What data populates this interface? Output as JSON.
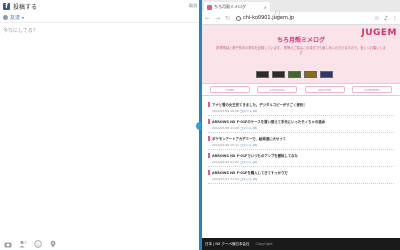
{
  "composer": {
    "title": "投稿する",
    "cancel": "取消",
    "privacy": "友達",
    "placeholder": "今なにしてる？"
  },
  "browser": {
    "tab_title": "ちろ月殻ミメログ",
    "url": "chi-ko0901.jugem.jp"
  },
  "blog": {
    "brand": "JUGEM",
    "title": "ちろ月殻ミメログ",
    "description": "携帯電話と電子系中の事件を記録しています。 携帯のご覧はこの書式でも楽しみいただけますので、宜しくお願いします",
    "menu": [
      "HOME",
      "CATEGORY",
      "ARCHIVE",
      "COMMENT"
    ],
    "posts": [
      {
        "title": "アナと雪の女王見てきました。デジタルコピーがすごく便利！",
        "date": "2014/07/29 19:56",
        "comments": "コメント (0)"
      },
      {
        "title": "ARROWS NX F-01Fのケースを買い替えて手元にいったモノちゃの道余",
        "date": "2014/07/28 11:08",
        "comments": "コメント (0)"
      },
      {
        "title": "ポケモンアートアカデミーで、絵師道に大せって",
        "date": "2014/07/26 10:17",
        "comments": "コメント (0)"
      },
      {
        "title": "ARROWS NX F-01Fでいつものアンプを撤除してみた",
        "date": "2014/07/24 21:03",
        "comments": "コメント (0)"
      },
      {
        "title": "ARROWS NX F-01Fを購入してきてすっかりだ",
        "date": "2014/07/17 11:54",
        "comments": "コメント (0)"
      }
    ],
    "footer_left": "日本 | NX クーペ偏日本会社",
    "footer_right": "Copyright"
  },
  "colors": {
    "accent": "#1e88c7",
    "blog_pink": "#d7336f",
    "facebook_blue": "#3b5998"
  }
}
